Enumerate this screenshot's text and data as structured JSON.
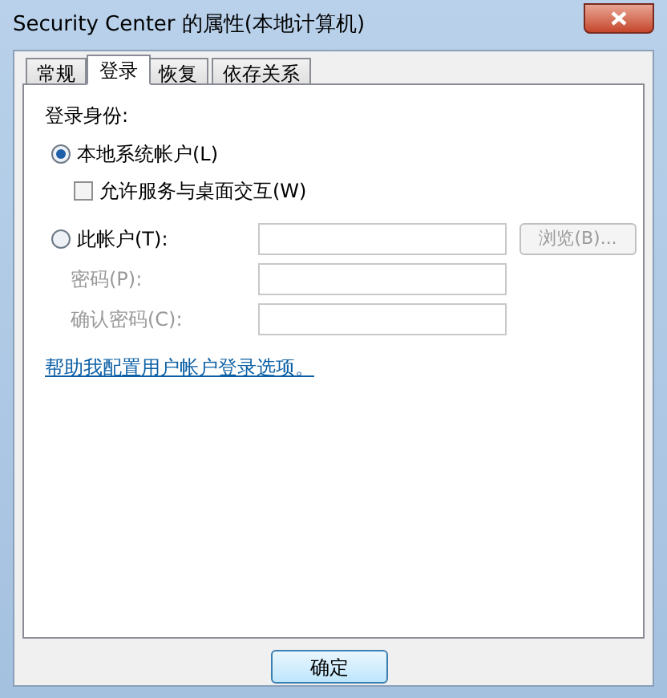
{
  "window": {
    "title": "Security Center 的属性(本地计算机)"
  },
  "tabs": [
    {
      "label": "常规",
      "selected": false
    },
    {
      "label": "登录",
      "selected": true
    },
    {
      "label": "恢复",
      "selected": false
    },
    {
      "label": "依存关系",
      "selected": false
    }
  ],
  "logon_as": {
    "heading": "登录身份:",
    "local_system": {
      "label": "本地系统帐户(L)",
      "selected": true
    },
    "interact_desktop": {
      "label": "允许服务与桌面交互(W)",
      "checked": false
    },
    "this_account": {
      "label": "此帐户(T):",
      "selected": false
    },
    "fields": [
      {
        "kind": "account",
        "disabled": true
      },
      {
        "label": "密码(P):",
        "kind": "password",
        "disabled": true
      },
      {
        "label": "确认密码(C):",
        "kind": "confirm",
        "disabled": true
      }
    ],
    "browse_button": {
      "label": "浏览(B)...",
      "disabled": true
    },
    "help_link": "帮助我配置用户帐户登录选项。"
  },
  "buttons": [
    {
      "label": "确定"
    }
  ]
}
